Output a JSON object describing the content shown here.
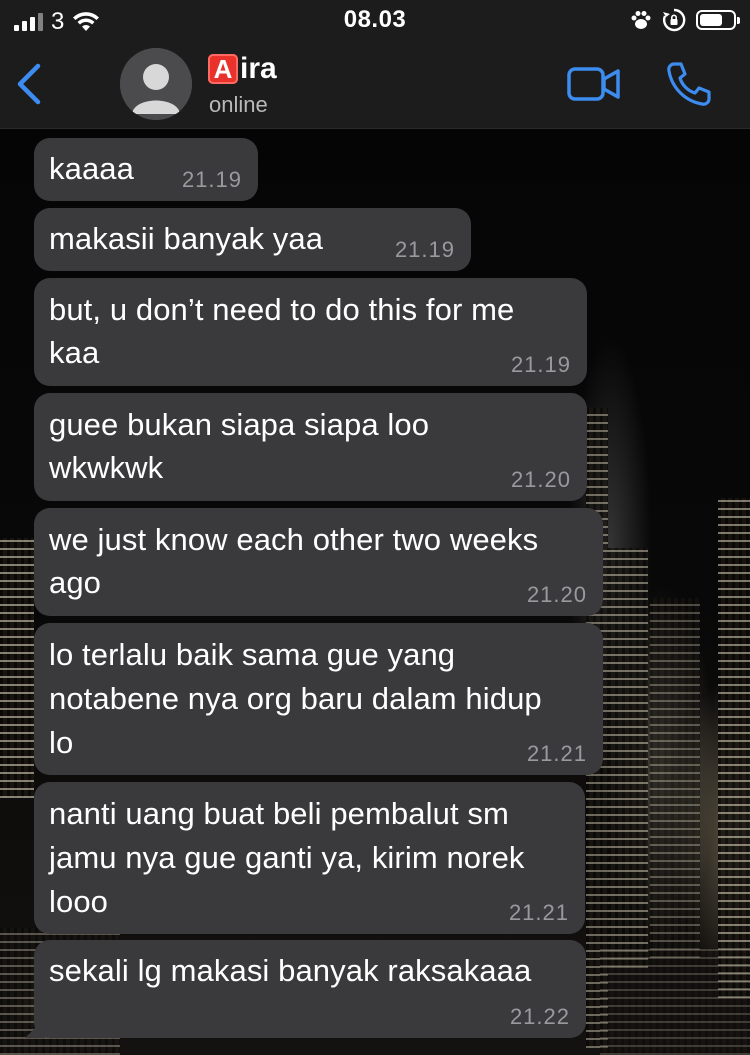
{
  "status_bar": {
    "carrier": "3",
    "time": "08.03"
  },
  "header": {
    "contact_badge": "A",
    "contact_name": "ira",
    "contact_status": "online"
  },
  "messages": [
    {
      "text": "kaaaa",
      "time": "21.19"
    },
    {
      "text": "makasii banyak yaa",
      "time": "21.19"
    },
    {
      "text": "but, u don’t need to do this for me\nkaa",
      "time": "21.19"
    },
    {
      "text": "guee bukan siapa siapa loo\nwkwkwk",
      "time": "21.20"
    },
    {
      "text": "we just know each other two weeks\nago",
      "time": "21.20"
    },
    {
      "text": "lo terlalu baik sama gue yang\nnotabene nya org baru dalam hidup\nlo",
      "time": "21.21"
    },
    {
      "text": "nanti uang buat beli pembalut sm\njamu nya gue ganti ya, kirim norek\nlooo",
      "time": "21.21"
    },
    {
      "text": "sekali lg makasi banyak raksakaaa",
      "time": "21.22"
    }
  ],
  "colors": {
    "bubble": "#3a3a3c",
    "accent": "#3d8cf0",
    "header": "#1c1c1c"
  },
  "icons": {
    "back": "chevron-left-icon",
    "video": "video-camera-icon",
    "phone": "phone-icon",
    "wifi": "wifi-icon",
    "paw": "paw-icon",
    "rotation_lock": "rotation-lock-icon",
    "battery": "battery-icon",
    "avatar": "default-avatar-icon"
  }
}
